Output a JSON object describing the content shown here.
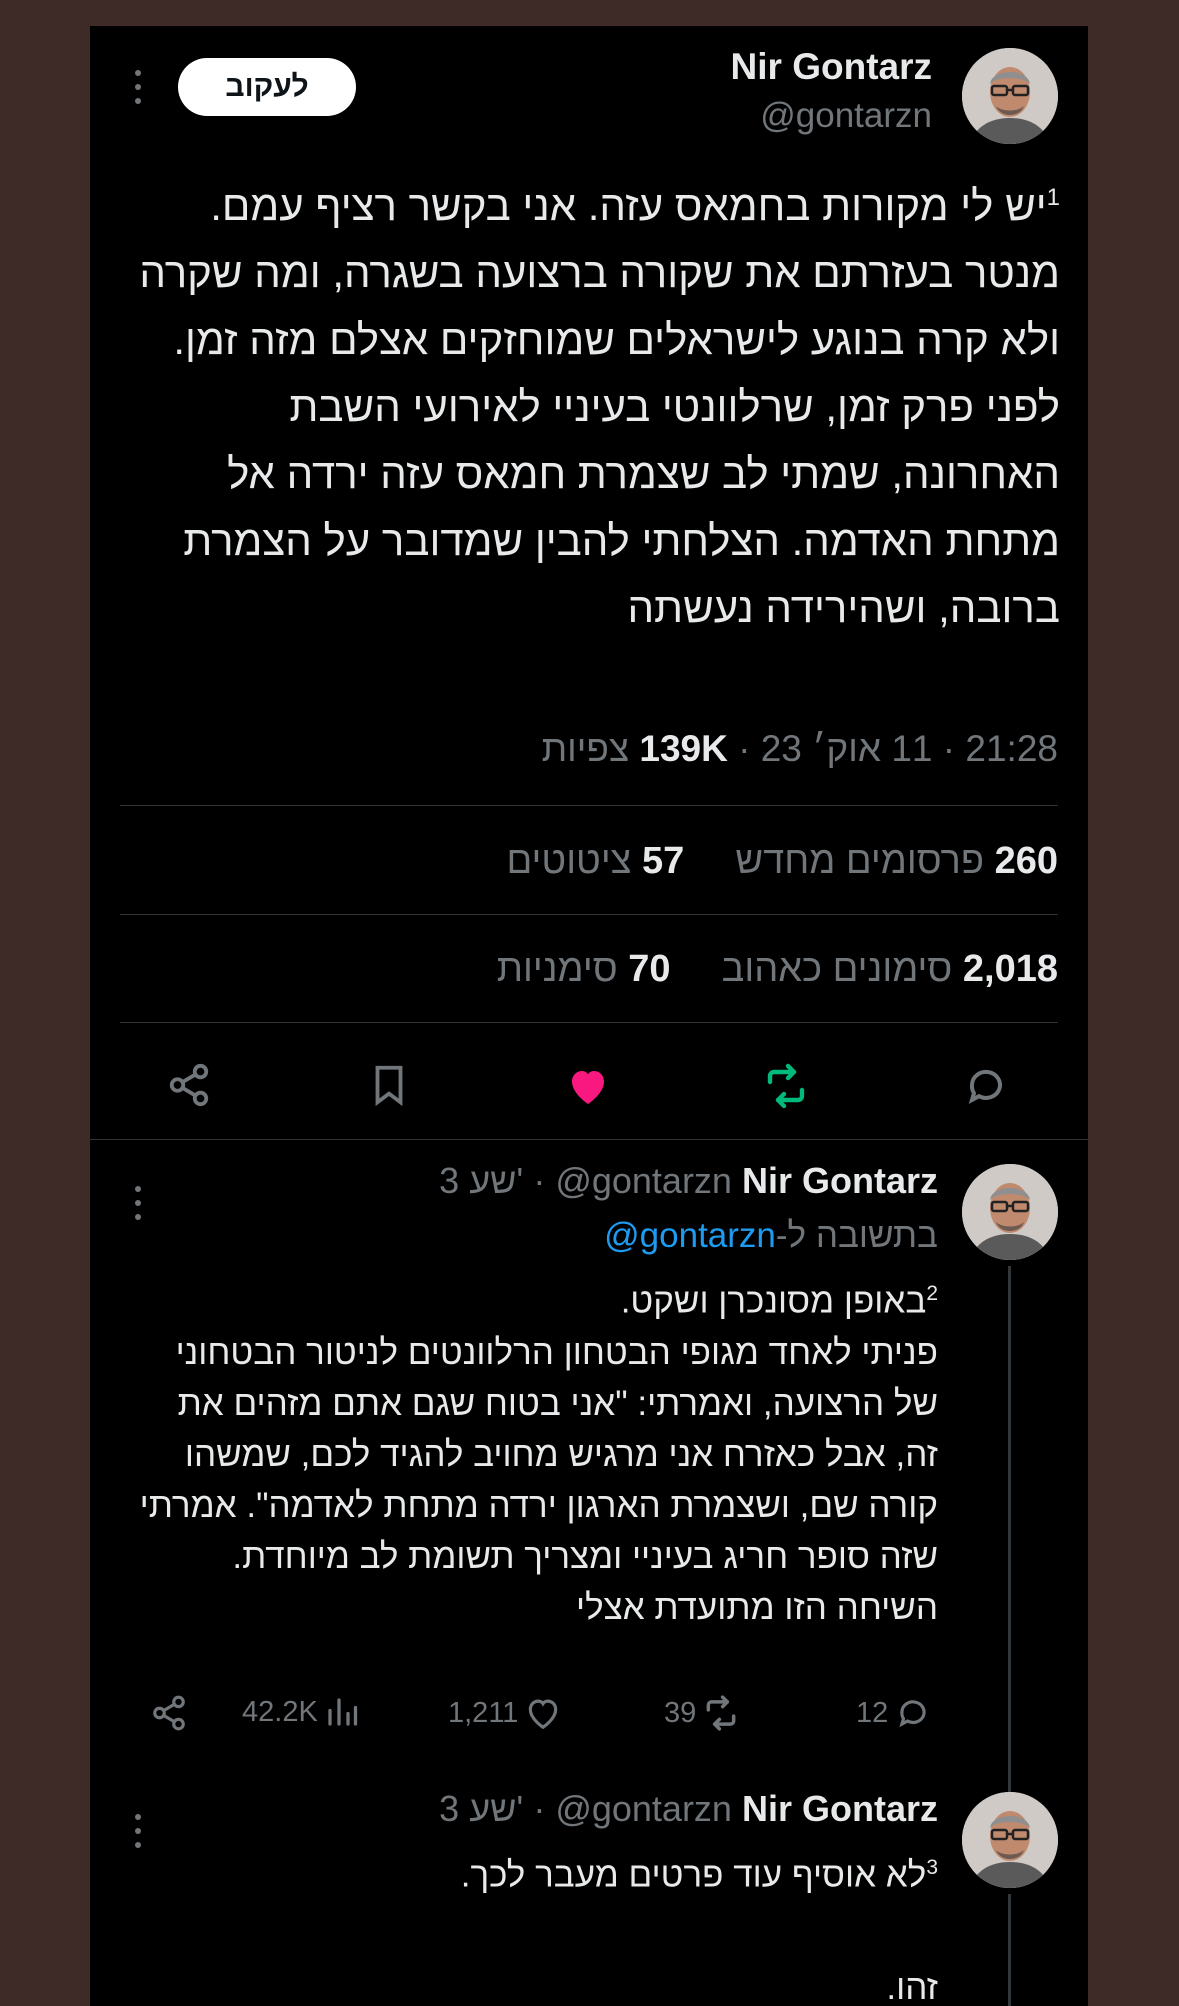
{
  "main_tweet": {
    "author_name": "Nir Gontarz",
    "handle": "@gontarzn",
    "follow_label": "לעקוב",
    "text": "יש לי מקורות בחמאס עזה. אני בקשר רציף עמם. מנטר בעזרתם את שקורה ברצועה בשגרה, ומה שקרה ולא קרה בנוגע לישראלים שמוחזקים אצלם מזה זמן.\nלפני פרק זמן, שרלוונטי בעיניי לאירועי השבת האחרונה, שמתי לב שצמרת חמאס עזה ירדה אל מתחת האדמה. הצלחתי להבין שמדובר על הצמרת ברובה, ושהירידה נעשתה",
    "thread_index": "1",
    "time": "21:28",
    "date": "11 אוק׳ 23",
    "views_count": "139K",
    "views_label": "צפיות",
    "reposts_count": "260",
    "reposts_label": "פרסומים מחדש",
    "quotes_count": "57",
    "quotes_label": "ציטוטים",
    "likes_count": "2,018",
    "likes_label": "סימונים כאהוב",
    "bookmarks_count": "70",
    "bookmarks_label": "סימניות",
    "colors": {
      "like": "#f91880",
      "repost": "#00ba7c",
      "accent": "#1d9bf0"
    }
  },
  "reply_1": {
    "author_name": "Nir Gontarz",
    "handle": "@gontarzn",
    "time_ago": "3 שע'",
    "replying_prefix": "בתשובה ל-",
    "replying_handle": "@gontarzn",
    "thread_index": "2",
    "text": "באופן מסונכרן ושקט.\nפניתי לאחד מגופי הבטחון הרלוונטים לניטור הבטחוני של הרצועה, ואמרתי: \"אני בטוח שגם אתם מזהים את זה, אבל כאזרח אני מרגיש מחויב להגיד לכם, שמשהו קורה שם, ושצמרת הארגון ירדה מתחת לאדמה\". אמרתי שזה סופר חריג בעיניי ומצריך תשומת לב מיוחדת.\nהשיחה הזו מתועדת אצלי",
    "replies": "12",
    "reposts": "39",
    "likes": "1,211",
    "views": "42.2K"
  },
  "reply_2": {
    "author_name": "Nir Gontarz",
    "handle": "@gontarzn",
    "time_ago": "3 שע'",
    "thread_index": "3",
    "text": "לא אוסיף עוד פרטים מעבר לכך.\n\nזהו."
  },
  "icons": {
    "share": "share-icon",
    "bookmark": "bookmark-icon",
    "like": "heart-icon",
    "repost": "repost-icon",
    "reply": "reply-icon",
    "views": "views-icon",
    "more": "more-icon"
  }
}
